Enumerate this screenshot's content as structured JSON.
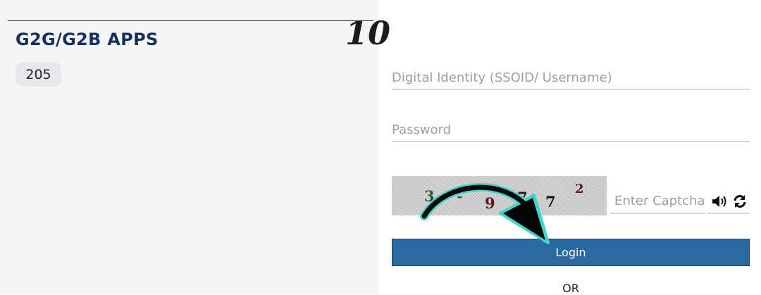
{
  "left_panel": {
    "section_title": "G2G/G2B APPS",
    "app_count": "205"
  },
  "annotation": {
    "step_number": "10"
  },
  "login_form": {
    "ssoid_placeholder": "Digital Identity (SSOID/ Username)",
    "password_placeholder": "Password",
    "captcha": {
      "image_characters": [
        "3",
        "-",
        "9",
        "7",
        "7",
        "2"
      ],
      "input_placeholder": "Enter Captcha",
      "audio_icon": "speaker-icon",
      "refresh_icon": "refresh-icon"
    },
    "login_label": "Login",
    "or_label": "OR"
  },
  "colors": {
    "login_button": "#2b6aa0",
    "title_text": "#17305f",
    "left_panel_bg": "#f5f5f5",
    "arrow_glow": "#3fd6c9"
  }
}
